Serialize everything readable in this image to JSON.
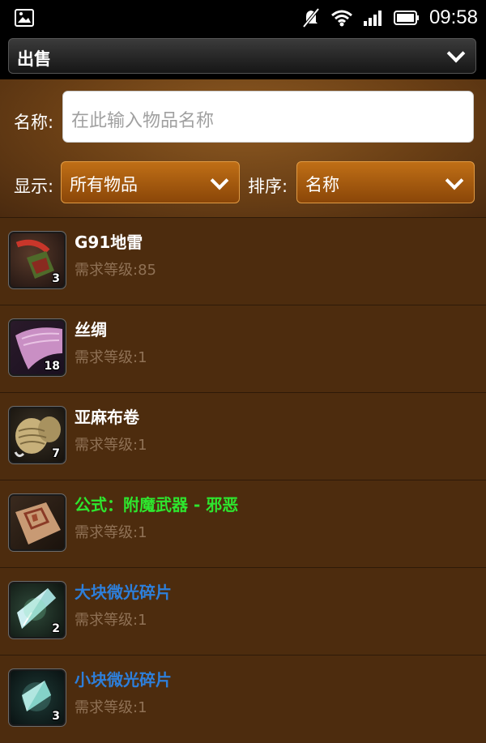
{
  "status_bar": {
    "time": "09:58"
  },
  "action_bar": {
    "mode_label": "出售"
  },
  "filters": {
    "name_label": "名称:",
    "name_placeholder": "在此输入物品名称",
    "display_label": "显示:",
    "display_value": "所有物品",
    "sort_label": "排序:",
    "sort_value": "名称"
  },
  "items": [
    {
      "name": "G91地雷",
      "requirement": "需求等级:85",
      "count": "3",
      "name_color": "#ffffff",
      "icon": "landmine-icon"
    },
    {
      "name": "丝绸",
      "requirement": "需求等级:1",
      "count": "18",
      "name_color": "#ffffff",
      "icon": "silk-cloth-icon"
    },
    {
      "name": "亚麻布卷",
      "requirement": "需求等级:1",
      "count": "7",
      "name_color": "#ffffff",
      "icon": "linen-bolt-icon"
    },
    {
      "name": "公式：附魔武器 - 邪恶",
      "requirement": "需求等级:1",
      "count": "",
      "name_color": "#2ee62e",
      "icon": "recipe-scroll-icon"
    },
    {
      "name": "大块微光碎片",
      "requirement": "需求等级:1",
      "count": "2",
      "name_color": "#2d7fdb",
      "icon": "large-crystal-shard-icon"
    },
    {
      "name": "小块微光碎片",
      "requirement": "需求等级:1",
      "count": "3",
      "name_color": "#2d7fdb",
      "icon": "small-crystal-shard-icon"
    }
  ]
}
